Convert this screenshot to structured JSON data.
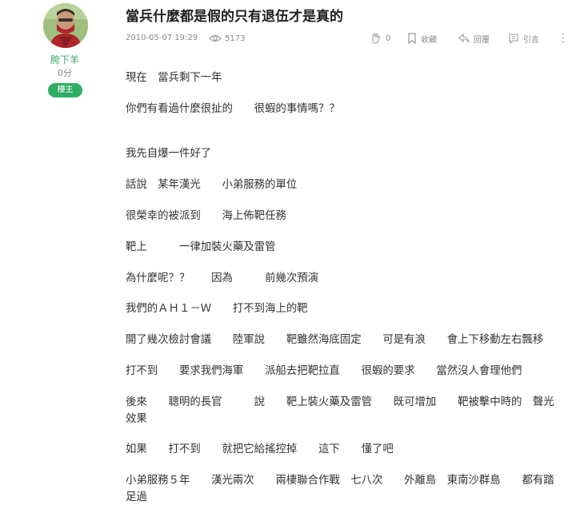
{
  "author": {
    "name": "胯下羊",
    "points": "0分",
    "badge": "樓主"
  },
  "post": {
    "title": "當兵什麼都是假的只有退伍才是真的",
    "date": "2010-05-07 19:29",
    "views": "5173",
    "likes": "0",
    "bookmark_label": "收藏",
    "reply_label": "回覆",
    "quote_label": "引言",
    "more_label": "⋮"
  },
  "body": {
    "lines": [
      "現在　當兵剩下一年",
      "你們有看過什麼很扯的　　很蝦的事情嗎？？",
      "我先自爆一件好了",
      "話說　某年漢光　　小弟服務的單位",
      "很榮幸的被派到　　海上佈靶任務",
      "靶上　　　一律加裝火藥及雷管",
      "為什麼呢？？　　因為　　　前幾次預演",
      "我們的ＡＨ１－Ｗ　　打不到海上的靶",
      "開了幾次檢討會議　　陸軍說　　靶雖然海底固定　　可是有浪　　會上下移動左右飄移",
      "打不到　　要求我們海軍　　派船去把靶拉直　　很蝦的要求　　當然沒人會理他們",
      "後來　　聰明的長官　　　說　　靶上裝火藥及雷管　　既可增加　　靶被擊中時的　聲光效果",
      "如果　　打不到　　就把它給搖控掉　　這下　　懂了吧",
      "小弟服務５年　　漢光兩次　　兩棲聯合作戰　七八次　　外離島　東南沙群島　　都有踏足過"
    ]
  },
  "colors": {
    "accent_green": "#2fae63",
    "author_name": "#3aa56b",
    "meta_gray": "#8a8a8a"
  },
  "icons": [
    "avatar-photo",
    "eye-icon",
    "clap-icon",
    "bookmark-icon",
    "reply-icon",
    "quote-icon",
    "more-icon"
  ]
}
